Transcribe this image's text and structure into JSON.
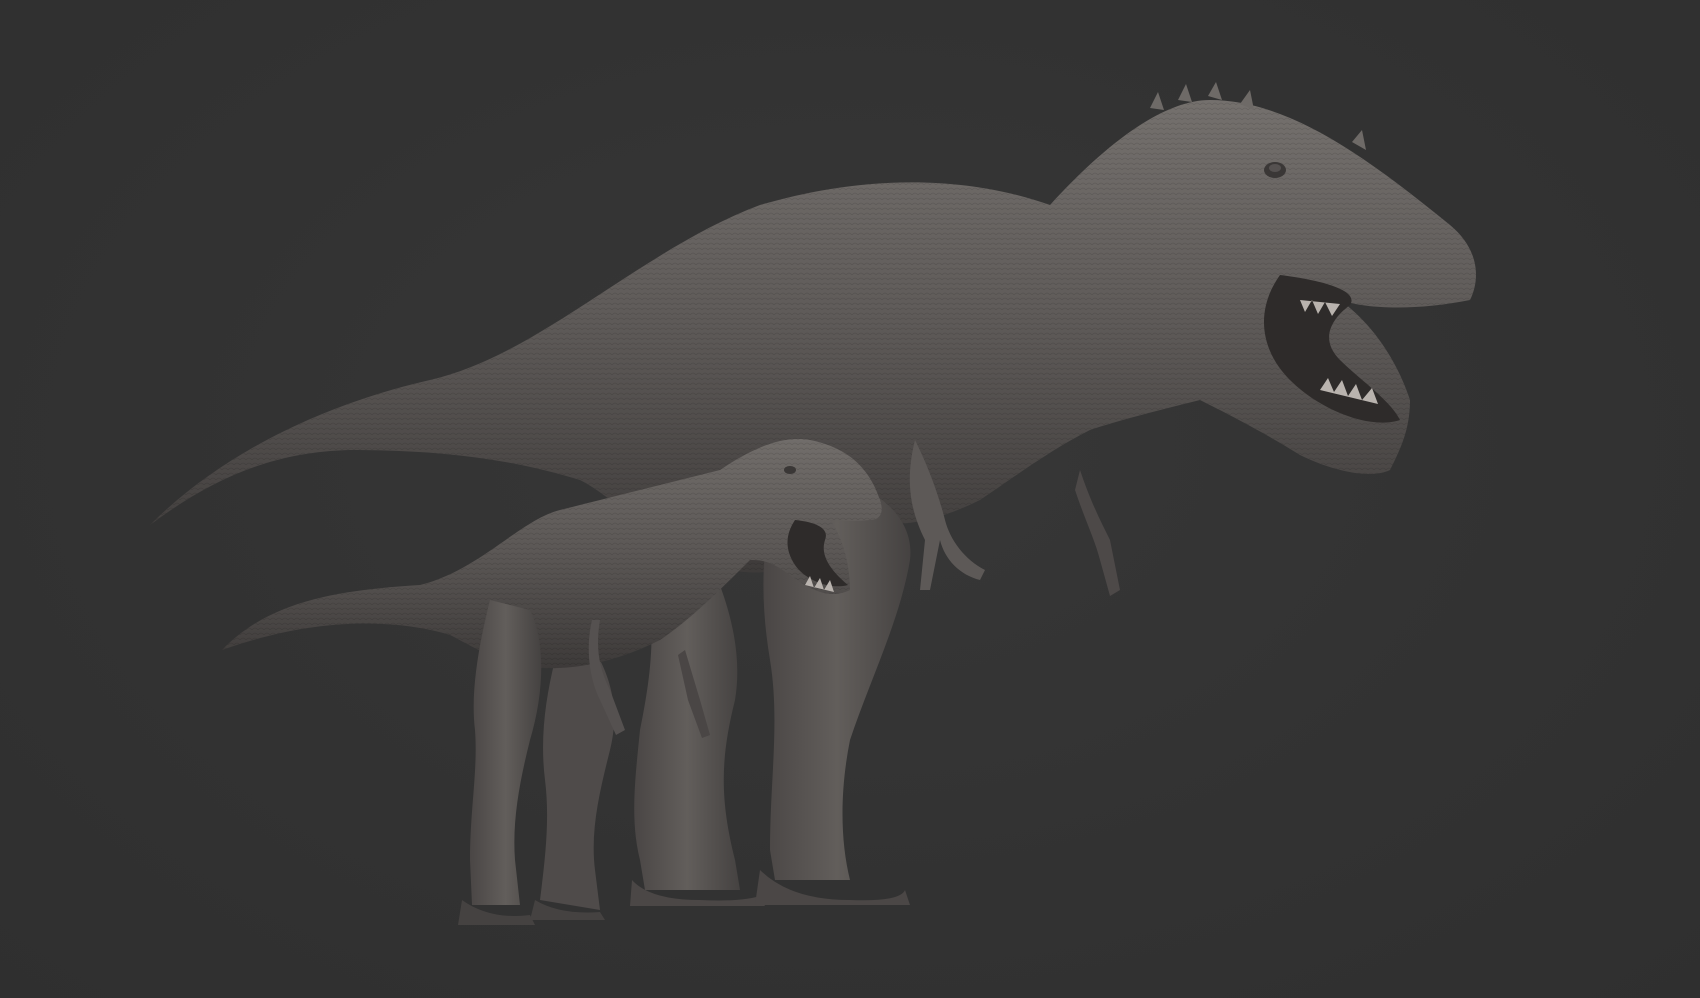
{
  "scene": {
    "background_color": "#333333",
    "subject_color": "#5e5a58",
    "subjects": [
      {
        "id": "adult",
        "description_icon": "tyrannosaur-adult-icon"
      },
      {
        "id": "juvenile",
        "description_icon": "tyrannosaur-juvenile-icon"
      }
    ]
  }
}
